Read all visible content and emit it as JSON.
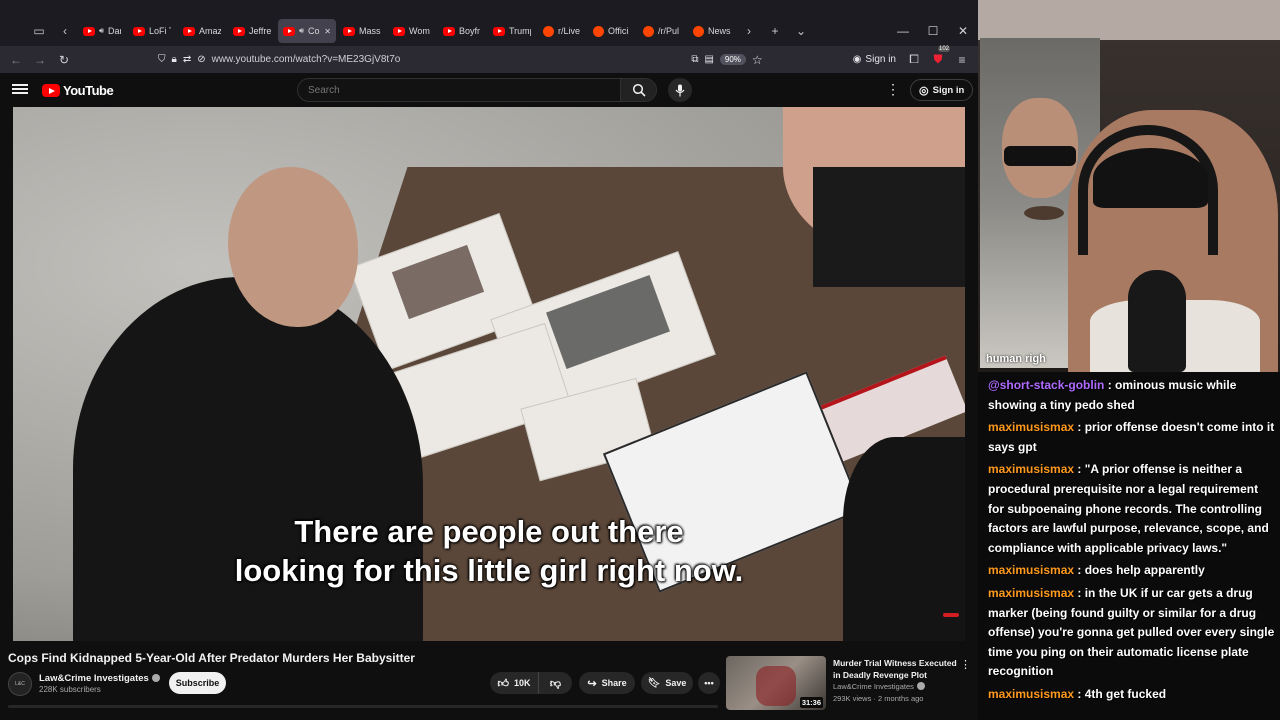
{
  "browser": {
    "tabs": [
      {
        "label": "Dark S",
        "icon": "youtube-icon",
        "audio": true,
        "active": false
      },
      {
        "label": "LoFi T",
        "icon": "youtube-icon",
        "audio": false,
        "active": false
      },
      {
        "label": "Amaz",
        "icon": "youtube-icon",
        "audio": false,
        "active": false
      },
      {
        "label": "Jeffre",
        "icon": "youtube-icon",
        "audio": false,
        "active": false
      },
      {
        "label": "Cop",
        "icon": "youtube-icon",
        "audio": true,
        "active": true
      },
      {
        "label": "Massi",
        "icon": "youtube-icon",
        "audio": false,
        "active": false
      },
      {
        "label": "Wom",
        "icon": "youtube-icon",
        "audio": false,
        "active": false
      },
      {
        "label": "Boyfr",
        "icon": "youtube-icon",
        "audio": false,
        "active": false
      },
      {
        "label": "Trump",
        "icon": "youtube-icon",
        "audio": false,
        "active": false
      },
      {
        "label": "r/Live",
        "icon": "reddit-icon",
        "audio": false,
        "active": false
      },
      {
        "label": "Offici",
        "icon": "reddit-icon",
        "audio": false,
        "active": false
      },
      {
        "label": "/r/Pul",
        "icon": "reddit-icon",
        "audio": false,
        "active": false
      },
      {
        "label": "News",
        "icon": "reddit-icon",
        "audio": false,
        "active": false
      }
    ],
    "url": "www.youtube.com/watch?v=ME23GjV8t7o",
    "zoom": "90%",
    "signin_label": "Sign in",
    "extension_badge": "102"
  },
  "youtube": {
    "logo_text": "YouTube",
    "search_placeholder": "Search",
    "signin_label": "Sign in",
    "caption_line1": "There are people out there",
    "caption_line2": "looking for this little girl right now.",
    "video_title": "Cops Find Kidnapped 5-Year-Old After Predator Murders Her Babysitter",
    "channel_name": "Law&Crime Investigates",
    "subscriber_count": "228K subscribers",
    "subscribe_label": "Subscribe",
    "like_count": "10K",
    "share_label": "Share",
    "save_label": "Save",
    "recommendation": {
      "title": "Murder Trial Witness Executed in Deadly Revenge Plot",
      "channel": "Law&Crime Investigates",
      "meta": "293K views · 2 months ago",
      "duration": "31:36"
    }
  },
  "webcam": {
    "overlay_text": "human righ"
  },
  "chat": {
    "messages": [
      {
        "user": "@short-stack-goblin",
        "user_color": "#b06bff",
        "text": " : ominous music while showing a tiny pedo shed"
      },
      {
        "user": "maximusismax",
        "user_color": "#ff9a1f",
        "text": " : prior offense doesn't come into it says gpt"
      },
      {
        "user": "maximusismax",
        "user_color": "#ff9a1f",
        "text": " : \"A prior offense is neither a procedural prerequisite nor a legal requirement for subpoenaing phone records. The controlling factors are lawful purpose, relevance, scope, and compliance with applicable privacy laws.\""
      },
      {
        "user": "maximusismax",
        "user_color": "#ff9a1f",
        "text": " : does help apparently"
      },
      {
        "user": "maximusismax",
        "user_color": "#ff9a1f",
        "text": " : in the UK if ur car gets a drug marker (being found guilty or similar for a drug offense) you're gonna get pulled over every single time you ping on their automatic license plate recognition"
      },
      {
        "user": "maximusismax",
        "user_color": "#ff9a1f",
        "text": " : 4th get fucked"
      }
    ]
  }
}
